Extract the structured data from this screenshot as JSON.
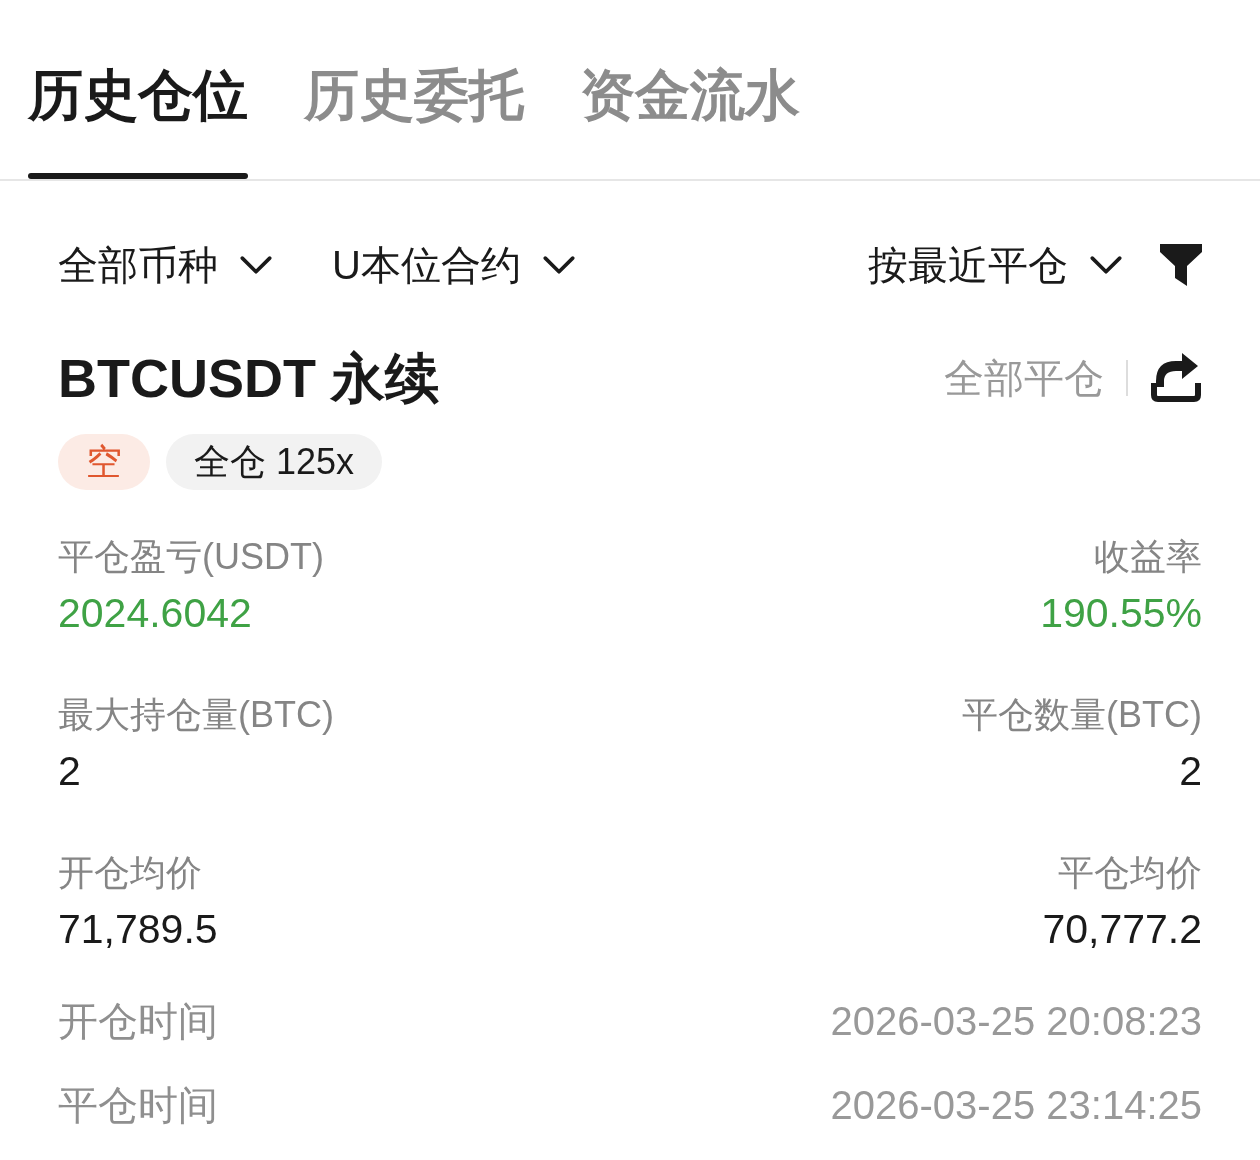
{
  "tabs": [
    {
      "label": "历史仓位",
      "selected": true
    },
    {
      "label": "历史委托",
      "selected": false
    },
    {
      "label": "资金流水",
      "selected": false
    }
  ],
  "filters": [
    {
      "label": "全部币种"
    },
    {
      "label": "U本位合约"
    }
  ],
  "sort": {
    "label": "按最近平仓"
  },
  "position": {
    "title": "BTCUSDT 永续",
    "close_all": "全部平仓",
    "side_tag": {
      "label": "空",
      "kind": "short"
    },
    "margin_tag": "全仓 125x",
    "metric_rows": [
      {
        "left": {
          "label": "平仓盈亏(USDT)",
          "value": "2024.6042",
          "kind": "profit"
        },
        "right": {
          "label": "收益率",
          "value": "190.55%",
          "kind": "profit"
        }
      },
      {
        "left": {
          "label": "最大持仓量(BTC)",
          "value": "2",
          "kind": "plain"
        },
        "right": {
          "label": "平仓数量(BTC)",
          "value": "2",
          "kind": "plain"
        }
      },
      {
        "left": {
          "label": "开仓均价",
          "value": "71,789.5",
          "kind": "plain"
        },
        "right": {
          "label": "平仓均价",
          "value": "70,777.2",
          "kind": "plain"
        }
      }
    ],
    "times": [
      {
        "label": "开仓时间",
        "value": "2026-03-25 20:08:23"
      },
      {
        "label": "平仓时间",
        "value": "2026-03-25 23:14:25"
      }
    ]
  }
}
